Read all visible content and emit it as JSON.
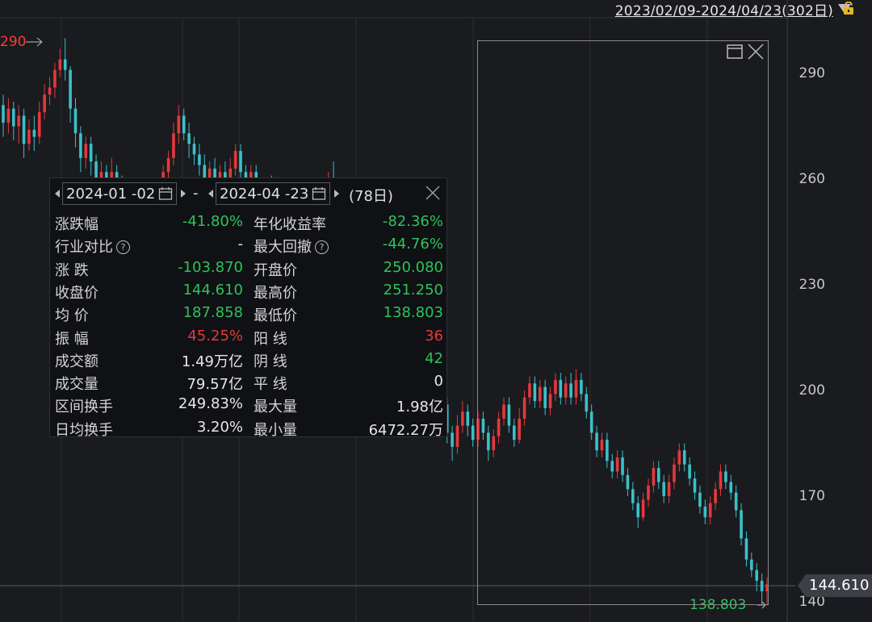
{
  "colors": {
    "up": "#e4393c",
    "down": "#2ec25c",
    "neutral": "#e6e6e6",
    "cyan": "#3cc0c8",
    "background": "#1a1b1f"
  },
  "header": {
    "range_label": "2023/02/09-2024/04/23(302日)"
  },
  "chart_data": {
    "type": "candlestick",
    "y_ticks": [
      "290",
      "260",
      "230",
      "200",
      "170",
      "140"
    ],
    "ylim": [
      138,
      301
    ],
    "peak_label": "290",
    "low_label": "138.803",
    "last_price": "144.610",
    "candles": [
      [
        281,
        276,
        284,
        272
      ],
      [
        276,
        280,
        283,
        273
      ],
      [
        280,
        275,
        282,
        271
      ],
      [
        275,
        278,
        281,
        270
      ],
      [
        278,
        270,
        280,
        266
      ],
      [
        270,
        274,
        277,
        268
      ],
      [
        274,
        272,
        278,
        268
      ],
      [
        272,
        279,
        282,
        270
      ],
      [
        279,
        284,
        287,
        277
      ],
      [
        284,
        286,
        289,
        281
      ],
      [
        286,
        291,
        293,
        283
      ],
      [
        291,
        294,
        297,
        289
      ],
      [
        294,
        291,
        300,
        288
      ],
      [
        291,
        280,
        292,
        276
      ],
      [
        280,
        273,
        283,
        269
      ],
      [
        273,
        266,
        275,
        262
      ],
      [
        266,
        270,
        272,
        263
      ],
      [
        270,
        265,
        272,
        261
      ],
      [
        265,
        258,
        267,
        254
      ],
      [
        258,
        262,
        265,
        255
      ],
      [
        262,
        258,
        264,
        253
      ],
      [
        258,
        262,
        266,
        256
      ],
      [
        262,
        259,
        264,
        254
      ],
      [
        259,
        252,
        261,
        249
      ],
      [
        252,
        248,
        255,
        245
      ],
      [
        248,
        252,
        254,
        246
      ],
      [
        252,
        249,
        255,
        246
      ],
      [
        249,
        245,
        251,
        242
      ],
      [
        245,
        250,
        253,
        244
      ],
      [
        250,
        247,
        252,
        243
      ],
      [
        247,
        255,
        257,
        245
      ],
      [
        255,
        262,
        264,
        253
      ],
      [
        262,
        266,
        268,
        259
      ],
      [
        266,
        273,
        276,
        264
      ],
      [
        273,
        278,
        281,
        270
      ],
      [
        278,
        273,
        280,
        271
      ],
      [
        273,
        270,
        276,
        266
      ],
      [
        270,
        267,
        272,
        264
      ],
      [
        267,
        264,
        270,
        261
      ],
      [
        264,
        260,
        267,
        256
      ],
      [
        260,
        263,
        265,
        257
      ],
      [
        263,
        258,
        266,
        255
      ],
      [
        258,
        262,
        264,
        256
      ],
      [
        262,
        259,
        265,
        256
      ],
      [
        259,
        263,
        266,
        257
      ],
      [
        263,
        268,
        270,
        261
      ],
      [
        268,
        262,
        270,
        260
      ],
      [
        262,
        258,
        264,
        255
      ],
      [
        258,
        262,
        264,
        256
      ],
      [
        262,
        257,
        264,
        254
      ],
      [
        257,
        254,
        259,
        250
      ],
      [
        254,
        258,
        260,
        252
      ],
      [
        258,
        255,
        261,
        252
      ],
      [
        255,
        251,
        257,
        248
      ],
      [
        251,
        254,
        256,
        249
      ],
      [
        254,
        250,
        256,
        247
      ],
      [
        250,
        253,
        255,
        248
      ],
      [
        253,
        250,
        255,
        247
      ],
      [
        250,
        248,
        252,
        245
      ],
      [
        248,
        251,
        253,
        246
      ],
      [
        251,
        249,
        253,
        246
      ],
      [
        249,
        252,
        255,
        247
      ],
      [
        252,
        256,
        258,
        250
      ],
      [
        256,
        260,
        262,
        254
      ],
      [
        260,
        258,
        265,
        256
      ],
      [
        258,
        252,
        260,
        250
      ],
      [
        250,
        247,
        252,
        244
      ],
      [
        247,
        244,
        249,
        241
      ],
      [
        244,
        240,
        246,
        237
      ],
      [
        240,
        242,
        244,
        238
      ],
      [
        242,
        238,
        244,
        236
      ],
      [
        238,
        236,
        240,
        233
      ],
      [
        236,
        233,
        238,
        230
      ],
      [
        233,
        228,
        235,
        226
      ],
      [
        228,
        224,
        230,
        221
      ],
      [
        224,
        220,
        226,
        218
      ],
      [
        220,
        216,
        222,
        214
      ],
      [
        216,
        214,
        219,
        212
      ],
      [
        214,
        217,
        219,
        212
      ],
      [
        217,
        213,
        219,
        211
      ],
      [
        213,
        210,
        215,
        208
      ],
      [
        210,
        214,
        216,
        209
      ],
      [
        214,
        211,
        216,
        208
      ],
      [
        211,
        208,
        213,
        206
      ],
      [
        208,
        211,
        213,
        207
      ],
      [
        210,
        196,
        212,
        195
      ],
      [
        196,
        188,
        198,
        185
      ],
      [
        188,
        184,
        190,
        180
      ],
      [
        184,
        190,
        193,
        182
      ],
      [
        190,
        194,
        197,
        188
      ],
      [
        194,
        190,
        196,
        187
      ],
      [
        190,
        186,
        192,
        184
      ],
      [
        186,
        192,
        194,
        184
      ],
      [
        192,
        188,
        194,
        186
      ],
      [
        188,
        183,
        190,
        180
      ],
      [
        183,
        187,
        189,
        181
      ],
      [
        187,
        192,
        194,
        185
      ],
      [
        192,
        196,
        198,
        190
      ],
      [
        196,
        190,
        198,
        188
      ],
      [
        190,
        186,
        192,
        184
      ],
      [
        186,
        192,
        195,
        185
      ],
      [
        192,
        198,
        200,
        190
      ],
      [
        198,
        202,
        204,
        196
      ],
      [
        202,
        197,
        204,
        195
      ],
      [
        197,
        201,
        203,
        195
      ],
      [
        201,
        195,
        203,
        193
      ],
      [
        195,
        199,
        201,
        193
      ],
      [
        199,
        203,
        205,
        197
      ],
      [
        203,
        198,
        205,
        196
      ],
      [
        198,
        202,
        204,
        196
      ],
      [
        202,
        198,
        205,
        196
      ],
      [
        198,
        203,
        206,
        196
      ],
      [
        203,
        199,
        205,
        197
      ],
      [
        199,
        194,
        201,
        192
      ],
      [
        194,
        188,
        196,
        186
      ],
      [
        188,
        183,
        190,
        181
      ],
      [
        183,
        186,
        188,
        181
      ],
      [
        186,
        180,
        188,
        178
      ],
      [
        180,
        177,
        182,
        175
      ],
      [
        177,
        181,
        183,
        175
      ],
      [
        181,
        176,
        183,
        174
      ],
      [
        176,
        172,
        178,
        170
      ],
      [
        172,
        168,
        174,
        166
      ],
      [
        168,
        164,
        170,
        161
      ],
      [
        164,
        169,
        171,
        163
      ],
      [
        169,
        173,
        175,
        167
      ],
      [
        173,
        178,
        180,
        171
      ],
      [
        178,
        174,
        180,
        172
      ],
      [
        174,
        170,
        176,
        168
      ],
      [
        170,
        174,
        176,
        168
      ],
      [
        174,
        179,
        181,
        172
      ],
      [
        179,
        183,
        185,
        177
      ],
      [
        183,
        179,
        185,
        177
      ],
      [
        179,
        175,
        181,
        173
      ],
      [
        175,
        171,
        177,
        169
      ],
      [
        171,
        167,
        173,
        165
      ],
      [
        167,
        164,
        169,
        162
      ],
      [
        164,
        168,
        170,
        162
      ],
      [
        168,
        172,
        174,
        166
      ],
      [
        172,
        177,
        179,
        170
      ],
      [
        177,
        174,
        179,
        172
      ],
      [
        174,
        171,
        176,
        169
      ],
      [
        171,
        166,
        173,
        164
      ],
      [
        166,
        158,
        168,
        156
      ],
      [
        158,
        152,
        160,
        150
      ],
      [
        152,
        149,
        154,
        147
      ],
      [
        149,
        146,
        151,
        143
      ],
      [
        146,
        143,
        148,
        139
      ],
      [
        143,
        145,
        147,
        139
      ]
    ]
  },
  "panel": {
    "start_date": "2024-01 -02",
    "end_date": "2024-04 -23",
    "separator": "-",
    "days": "(78日)",
    "help_mark": "?",
    "rows": [
      {
        "l1": "涨跌幅",
        "v1": "-41.80%",
        "c1": "down",
        "l2": "年化收益率",
        "v2": "-82.36%",
        "c2": "down"
      },
      {
        "l1": "行业对比",
        "v1": "-",
        "c1": "neutral",
        "l2": "最大回撤",
        "v2": "-44.76%",
        "c2": "down"
      },
      {
        "l1": "涨  跌",
        "v1": "-103.870",
        "c1": "down",
        "l2": "开盘价",
        "v2": "250.080",
        "c2": "down"
      },
      {
        "l1": "收盘价",
        "v1": "144.610",
        "c1": "down",
        "l2": "最高价",
        "v2": "251.250",
        "c2": "down"
      },
      {
        "l1": "均  价",
        "v1": "187.858",
        "c1": "down",
        "l2": "最低价",
        "v2": "138.803",
        "c2": "down"
      },
      {
        "l1": "振  幅",
        "v1": "45.25%",
        "c1": "up",
        "l2": "阳  线",
        "v2": "36",
        "c2": "up"
      },
      {
        "l1": "成交额",
        "v1": "1.49万亿",
        "c1": "neutral",
        "l2": "阴  线",
        "v2": "42",
        "c2": "down"
      },
      {
        "l1": "成交量",
        "v1": "79.57亿",
        "c1": "neutral",
        "l2": "平  线",
        "v2": "0",
        "c2": "neutral"
      },
      {
        "l1": "区间换手",
        "v1": "249.83%",
        "c1": "neutral",
        "l2": "最大量",
        "v2": "1.98亿",
        "c2": "neutral"
      },
      {
        "l1": "日均换手",
        "v1": "3.20%",
        "c1": "neutral",
        "l2": "最小量",
        "v2": "6472.27万",
        "c2": "neutral"
      }
    ]
  }
}
